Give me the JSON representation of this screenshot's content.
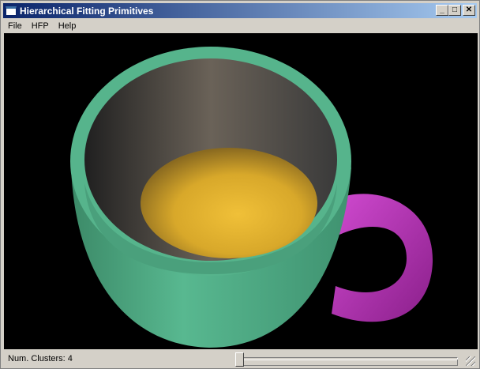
{
  "window": {
    "title": "Hierarchical Fitting Primitives"
  },
  "menu": [
    "File",
    "HFP",
    "Help"
  ],
  "status": {
    "text": "Num. Clusters: 4",
    "slider_fraction": 0.0
  },
  "colors": {
    "mug": "#4fb58a",
    "handle": "#c63bc6",
    "liquid": "#e0b030",
    "background": "#000000"
  }
}
